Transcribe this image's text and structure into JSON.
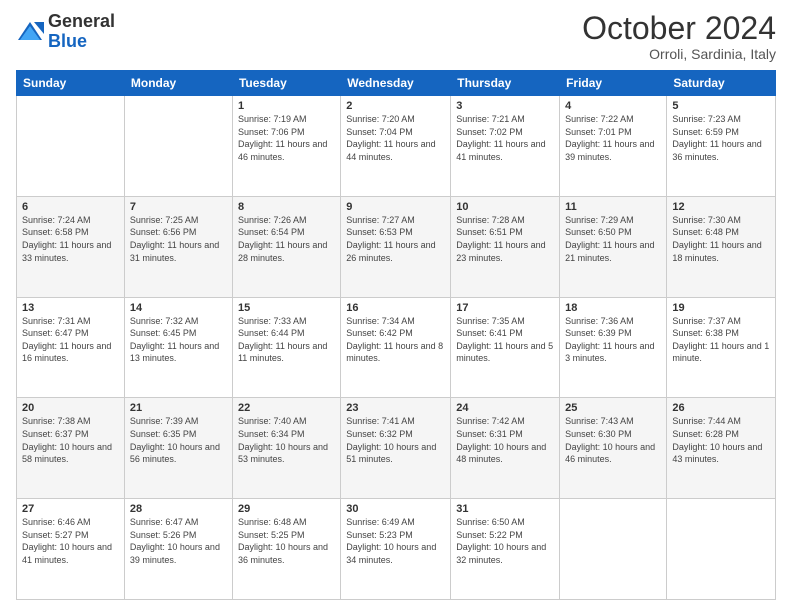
{
  "header": {
    "logo_general": "General",
    "logo_blue": "Blue",
    "month_title": "October 2024",
    "location": "Orroli, Sardinia, Italy"
  },
  "days_of_week": [
    "Sunday",
    "Monday",
    "Tuesday",
    "Wednesday",
    "Thursday",
    "Friday",
    "Saturday"
  ],
  "weeks": [
    [
      {
        "day": "",
        "info": ""
      },
      {
        "day": "",
        "info": ""
      },
      {
        "day": "1",
        "info": "Sunrise: 7:19 AM\nSunset: 7:06 PM\nDaylight: 11 hours and 46 minutes."
      },
      {
        "day": "2",
        "info": "Sunrise: 7:20 AM\nSunset: 7:04 PM\nDaylight: 11 hours and 44 minutes."
      },
      {
        "day": "3",
        "info": "Sunrise: 7:21 AM\nSunset: 7:02 PM\nDaylight: 11 hours and 41 minutes."
      },
      {
        "day": "4",
        "info": "Sunrise: 7:22 AM\nSunset: 7:01 PM\nDaylight: 11 hours and 39 minutes."
      },
      {
        "day": "5",
        "info": "Sunrise: 7:23 AM\nSunset: 6:59 PM\nDaylight: 11 hours and 36 minutes."
      }
    ],
    [
      {
        "day": "6",
        "info": "Sunrise: 7:24 AM\nSunset: 6:58 PM\nDaylight: 11 hours and 33 minutes."
      },
      {
        "day": "7",
        "info": "Sunrise: 7:25 AM\nSunset: 6:56 PM\nDaylight: 11 hours and 31 minutes."
      },
      {
        "day": "8",
        "info": "Sunrise: 7:26 AM\nSunset: 6:54 PM\nDaylight: 11 hours and 28 minutes."
      },
      {
        "day": "9",
        "info": "Sunrise: 7:27 AM\nSunset: 6:53 PM\nDaylight: 11 hours and 26 minutes."
      },
      {
        "day": "10",
        "info": "Sunrise: 7:28 AM\nSunset: 6:51 PM\nDaylight: 11 hours and 23 minutes."
      },
      {
        "day": "11",
        "info": "Sunrise: 7:29 AM\nSunset: 6:50 PM\nDaylight: 11 hours and 21 minutes."
      },
      {
        "day": "12",
        "info": "Sunrise: 7:30 AM\nSunset: 6:48 PM\nDaylight: 11 hours and 18 minutes."
      }
    ],
    [
      {
        "day": "13",
        "info": "Sunrise: 7:31 AM\nSunset: 6:47 PM\nDaylight: 11 hours and 16 minutes."
      },
      {
        "day": "14",
        "info": "Sunrise: 7:32 AM\nSunset: 6:45 PM\nDaylight: 11 hours and 13 minutes."
      },
      {
        "day": "15",
        "info": "Sunrise: 7:33 AM\nSunset: 6:44 PM\nDaylight: 11 hours and 11 minutes."
      },
      {
        "day": "16",
        "info": "Sunrise: 7:34 AM\nSunset: 6:42 PM\nDaylight: 11 hours and 8 minutes."
      },
      {
        "day": "17",
        "info": "Sunrise: 7:35 AM\nSunset: 6:41 PM\nDaylight: 11 hours and 5 minutes."
      },
      {
        "day": "18",
        "info": "Sunrise: 7:36 AM\nSunset: 6:39 PM\nDaylight: 11 hours and 3 minutes."
      },
      {
        "day": "19",
        "info": "Sunrise: 7:37 AM\nSunset: 6:38 PM\nDaylight: 11 hours and 1 minute."
      }
    ],
    [
      {
        "day": "20",
        "info": "Sunrise: 7:38 AM\nSunset: 6:37 PM\nDaylight: 10 hours and 58 minutes."
      },
      {
        "day": "21",
        "info": "Sunrise: 7:39 AM\nSunset: 6:35 PM\nDaylight: 10 hours and 56 minutes."
      },
      {
        "day": "22",
        "info": "Sunrise: 7:40 AM\nSunset: 6:34 PM\nDaylight: 10 hours and 53 minutes."
      },
      {
        "day": "23",
        "info": "Sunrise: 7:41 AM\nSunset: 6:32 PM\nDaylight: 10 hours and 51 minutes."
      },
      {
        "day": "24",
        "info": "Sunrise: 7:42 AM\nSunset: 6:31 PM\nDaylight: 10 hours and 48 minutes."
      },
      {
        "day": "25",
        "info": "Sunrise: 7:43 AM\nSunset: 6:30 PM\nDaylight: 10 hours and 46 minutes."
      },
      {
        "day": "26",
        "info": "Sunrise: 7:44 AM\nSunset: 6:28 PM\nDaylight: 10 hours and 43 minutes."
      }
    ],
    [
      {
        "day": "27",
        "info": "Sunrise: 6:46 AM\nSunset: 5:27 PM\nDaylight: 10 hours and 41 minutes."
      },
      {
        "day": "28",
        "info": "Sunrise: 6:47 AM\nSunset: 5:26 PM\nDaylight: 10 hours and 39 minutes."
      },
      {
        "day": "29",
        "info": "Sunrise: 6:48 AM\nSunset: 5:25 PM\nDaylight: 10 hours and 36 minutes."
      },
      {
        "day": "30",
        "info": "Sunrise: 6:49 AM\nSunset: 5:23 PM\nDaylight: 10 hours and 34 minutes."
      },
      {
        "day": "31",
        "info": "Sunrise: 6:50 AM\nSunset: 5:22 PM\nDaylight: 10 hours and 32 minutes."
      },
      {
        "day": "",
        "info": ""
      },
      {
        "day": "",
        "info": ""
      }
    ]
  ]
}
